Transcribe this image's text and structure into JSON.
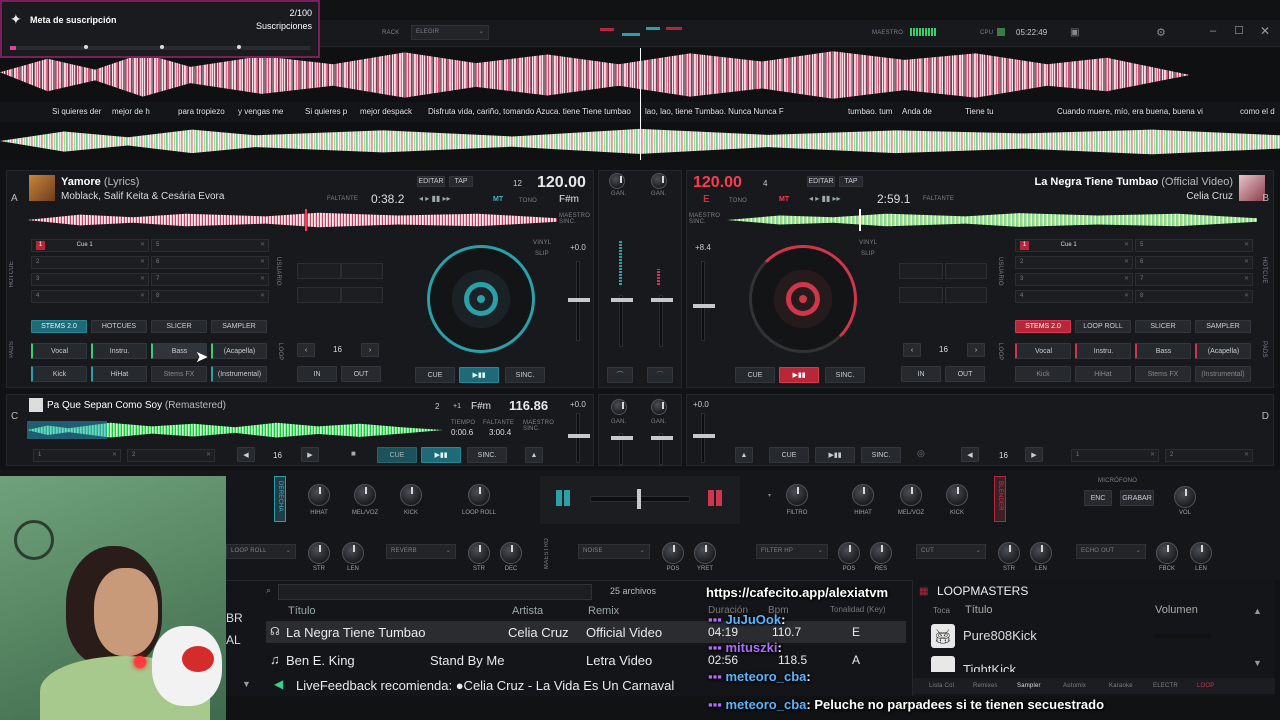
{
  "subscription_goal": {
    "title": "Meta de suscripción",
    "count": "2/100",
    "label": "Suscripciones"
  },
  "top_bar": {
    "rack_label": "RACK",
    "rack_select": "ELEGIR",
    "master_label": "MAESTRO",
    "cpu_label": "CPU",
    "clock": "05:22:49"
  },
  "lyrics": {
    "top": [
      "Si quieres der",
      "mejor de h",
      "para tropiezo",
      "y vengas me",
      "Si quieres p",
      "mejor despack",
      "Disfruta vida, cariño, tomando Azuca. tiene Tiene tumbao",
      "lao, lao, tiene Tumbao. Nunca Nunca F",
      "tumbao. tum",
      "Anda de",
      "Tiene tu",
      "Cuando muere, mío, era buena, buena vi",
      "como el d"
    ]
  },
  "deck_a": {
    "letter": "A",
    "title": "Yamore",
    "title_suffix": "(Lyrics)",
    "artist": "Moblack, Salif Keita & Cesária Evora",
    "remaining_label": "FALTANTE",
    "time": "0:38.2",
    "edit": "EDITAR",
    "tap": "TAP",
    "bpm": "120.00",
    "beats": "12",
    "mt": "MT",
    "tone": "TONO",
    "key": "F#m",
    "master_sync": "MAESTRO SINC.",
    "hotcue_label": "HOTCUE",
    "usuario_label": "USUARIO",
    "cues": [
      "Cue 1",
      "2",
      "3",
      "4",
      "5",
      "6",
      "7",
      "8"
    ],
    "tabs": [
      "STEMS 2.0",
      "HOTCUES",
      "SLICER",
      "SAMPLER"
    ],
    "stems": [
      "Vocal",
      "Instru.",
      "Bass",
      "(Acapella)",
      "Kick",
      "HiHat",
      "Stems FX",
      "(Instrumental)"
    ],
    "loop_size": "16",
    "in": "IN",
    "out": "OUT",
    "cue": "CUE",
    "play": "▶▮▮",
    "sync": "SINC.",
    "pitch": "+0.0",
    "vinyl": "VINYL",
    "slip": "SLIP",
    "pads_label": "PADS",
    "loop_label": "LOOP"
  },
  "deck_b": {
    "letter": "B",
    "title": "La Negra Tiene Tumbao",
    "title_suffix": "(Official Video)",
    "artist": "Celia Cruz",
    "remaining_label": "FALTANTE",
    "time": "2:59.1",
    "edit": "EDITAR",
    "tap": "TAP",
    "bpm": "120.00",
    "beats": "4",
    "tone": "TONO",
    "key": "E",
    "mt": "MT",
    "master_sync": "MAESTRO SINC.",
    "cues": [
      "Cue 1",
      "2",
      "3",
      "4",
      "5",
      "6",
      "7",
      "8"
    ],
    "tabs": [
      "STEMS 2.0",
      "LOOP ROLL",
      "SLICER",
      "SAMPLER"
    ],
    "stems": [
      "Vocal",
      "Instru.",
      "Bass",
      "(Acapella)",
      "Kick",
      "HiHat",
      "Stems FX",
      "(Instrumental)"
    ],
    "loop_size": "16",
    "in": "IN",
    "out": "OUT",
    "cue": "CUE",
    "play": "▶▮▮",
    "sync": "SINC.",
    "pitch": "+8.4",
    "vinyl": "VINYL",
    "slip": "SLIP",
    "hotcue_label": "HOTCUE",
    "usuario_label": "USUARIO",
    "pads_label": "PADS",
    "loop_label": "LOOP"
  },
  "deck_c": {
    "letter": "C",
    "title": "Pa Que Sepan Como Soy",
    "title_suffix": "(Remastered)",
    "beats": "2",
    "offset": "+1",
    "key": "F#m",
    "bpm": "116.86",
    "time_label": "TIEMPO",
    "time": "0:00.6",
    "remaining_label": "FALTANTE",
    "remaining": "3:00.4",
    "master_sync": "MAESTRO SINC.",
    "pitch": "+0.0",
    "cue": "CUE",
    "sync": "SINC.",
    "loop_size": "16",
    "cells": [
      "1",
      "2"
    ]
  },
  "deck_d": {
    "letter": "D",
    "pitch": "+0.0",
    "cue": "CUE",
    "sync": "SINC.",
    "loop_size": "16",
    "cells": [
      "1",
      "2"
    ]
  },
  "mixer": {
    "gain": "GAN.",
    "gain2": "GAN."
  },
  "fx": {
    "left_knobs": [
      "HIHAT",
      "MEL/VOZ",
      "KICK",
      "LOOP ROLL"
    ],
    "left_label": "DERECHA",
    "right_label": "BLENDER",
    "filtro": "FILTRO",
    "right_knobs": [
      "HIHAT",
      "MEL/VOZ",
      "KICK"
    ],
    "mic_label": "MICRÓFONO",
    "enc": "ENC",
    "grabar": "GRABAR",
    "vol": "VOL",
    "row2_left_select1": "LOOP ROLL",
    "row2_left_select2": "REVERB",
    "row2_knobs_a": [
      "STR",
      "LEN"
    ],
    "row2_knobs_b": [
      "STR",
      "DEC"
    ],
    "noise": "NOISE",
    "pos": "POS",
    "yret": "YRET",
    "master_vertical": "MAESTRO",
    "filter_hp": "FILTER HP",
    "cut": "CUT",
    "echo_out": "ECHO OUT",
    "row2_knobs_c": [
      "POS",
      "RES"
    ],
    "row2_knobs_d": [
      "STR",
      "LEN"
    ],
    "row2_knobs_e": [
      "FBCK",
      "LEN"
    ]
  },
  "browser": {
    "search_placeholder": "",
    "file_count": "25 archivos",
    "columns": [
      "Título",
      "Artista",
      "Remix",
      "Duración",
      "Bpm",
      "Tonalidad (Key)"
    ],
    "rows": [
      {
        "title": "La Negra Tiene Tumbao",
        "artist": "Celia Cruz",
        "remix": "Official Video",
        "duration": "04:19",
        "bpm": "110.7",
        "key": "E"
      },
      {
        "title": "Stand By Me",
        "artist": "Ben E. King",
        "remix": "Letra  Video",
        "duration": "02:56",
        "bpm": "118.5",
        "key": "A"
      }
    ],
    "live_feedback": "LiveFeedback recomienda: ●Celia Cruz - La Vida Es Un Carnaval",
    "side_labels": [
      "BR",
      "AL"
    ]
  },
  "sampler": {
    "brand": "LOOPMASTERS",
    "columns": [
      "Toca",
      "Título",
      "Volumen"
    ],
    "items": [
      "Pure808Kick",
      "TightKick"
    ],
    "tabs": [
      "Lista Col",
      "Remixes",
      "Sampler",
      "Automix",
      "Karaoke",
      "ELECTR",
      "LOOP"
    ]
  },
  "overlay": {
    "url": "https://cafecito.app/alexiatvm",
    "chat": [
      {
        "user": "JuJuOok",
        "text": ":"
      },
      {
        "user": "mituszki",
        "text": ":"
      },
      {
        "user": "meteoro_cba",
        "text": ":"
      },
      {
        "user": "meteoro_cba",
        "text": ": Peluche no parpadees si te tienen secuestrado"
      }
    ]
  },
  "colors": {
    "teal": "#1d6b78",
    "red": "#b8263a",
    "bpm_left": "#e8e8e8",
    "bpm_right": "#ff3b4f",
    "accent_blue": "#5ab4ff"
  }
}
